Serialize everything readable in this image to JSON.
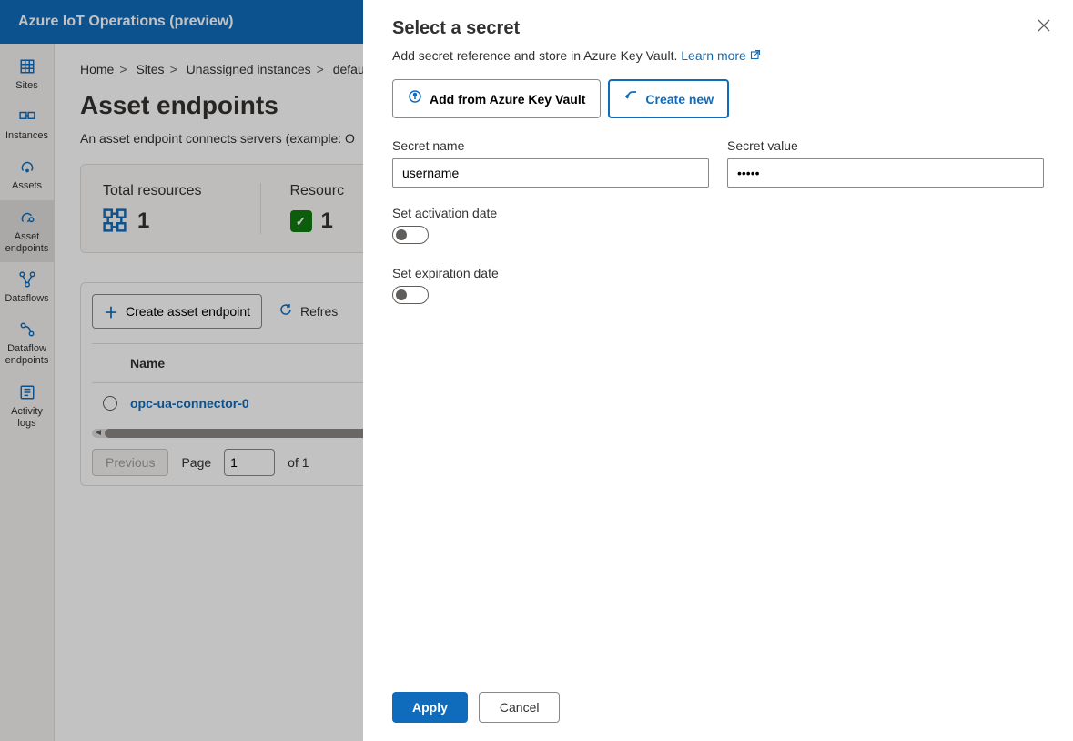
{
  "header": {
    "title": "Azure IoT Operations (preview)"
  },
  "sidebar": {
    "items": [
      {
        "label": "Sites",
        "icon": "building-icon"
      },
      {
        "label": "Instances",
        "icon": "instances-icon"
      },
      {
        "label": "Assets",
        "icon": "asset-icon"
      },
      {
        "label": "Asset endpoints",
        "icon": "asset-endpoint-icon",
        "selected": true
      },
      {
        "label": "Dataflows",
        "icon": "dataflow-icon"
      },
      {
        "label": "Dataflow endpoints",
        "icon": "dataflow-endpoint-icon"
      },
      {
        "label": "Activity logs",
        "icon": "activity-logs-icon"
      }
    ]
  },
  "breadcrumb": {
    "items": [
      "Home",
      "Sites",
      "Unassigned instances",
      "default"
    ]
  },
  "page": {
    "title": "Asset endpoints",
    "description": "An asset endpoint connects servers (example: O"
  },
  "stats": [
    {
      "label": "Total resources",
      "value": "1",
      "icon": "grid"
    },
    {
      "label": "Resourc",
      "value": "1",
      "icon": "check"
    }
  ],
  "toolbar": {
    "create_label": "Create asset endpoint",
    "refresh_label": "Refres"
  },
  "table": {
    "header": "Name",
    "rows": [
      {
        "name": "opc-ua-connector-0"
      }
    ]
  },
  "pagination": {
    "prev_label": "Previous",
    "page_label": "Page",
    "page_value": "1",
    "of_label": "of 1"
  },
  "panel": {
    "title": "Select a secret",
    "description": "Add secret reference and store in Azure Key Vault. ",
    "learn_more": "Learn more",
    "mode_keyvault": "Add from Azure Key Vault",
    "mode_create": "Create new",
    "secret_name_label": "Secret name",
    "secret_name_value": "username",
    "secret_value_label": "Secret value",
    "secret_value_value": "•••••",
    "activation_label": "Set activation date",
    "expiration_label": "Set expiration date",
    "apply_label": "Apply",
    "cancel_label": "Cancel"
  }
}
